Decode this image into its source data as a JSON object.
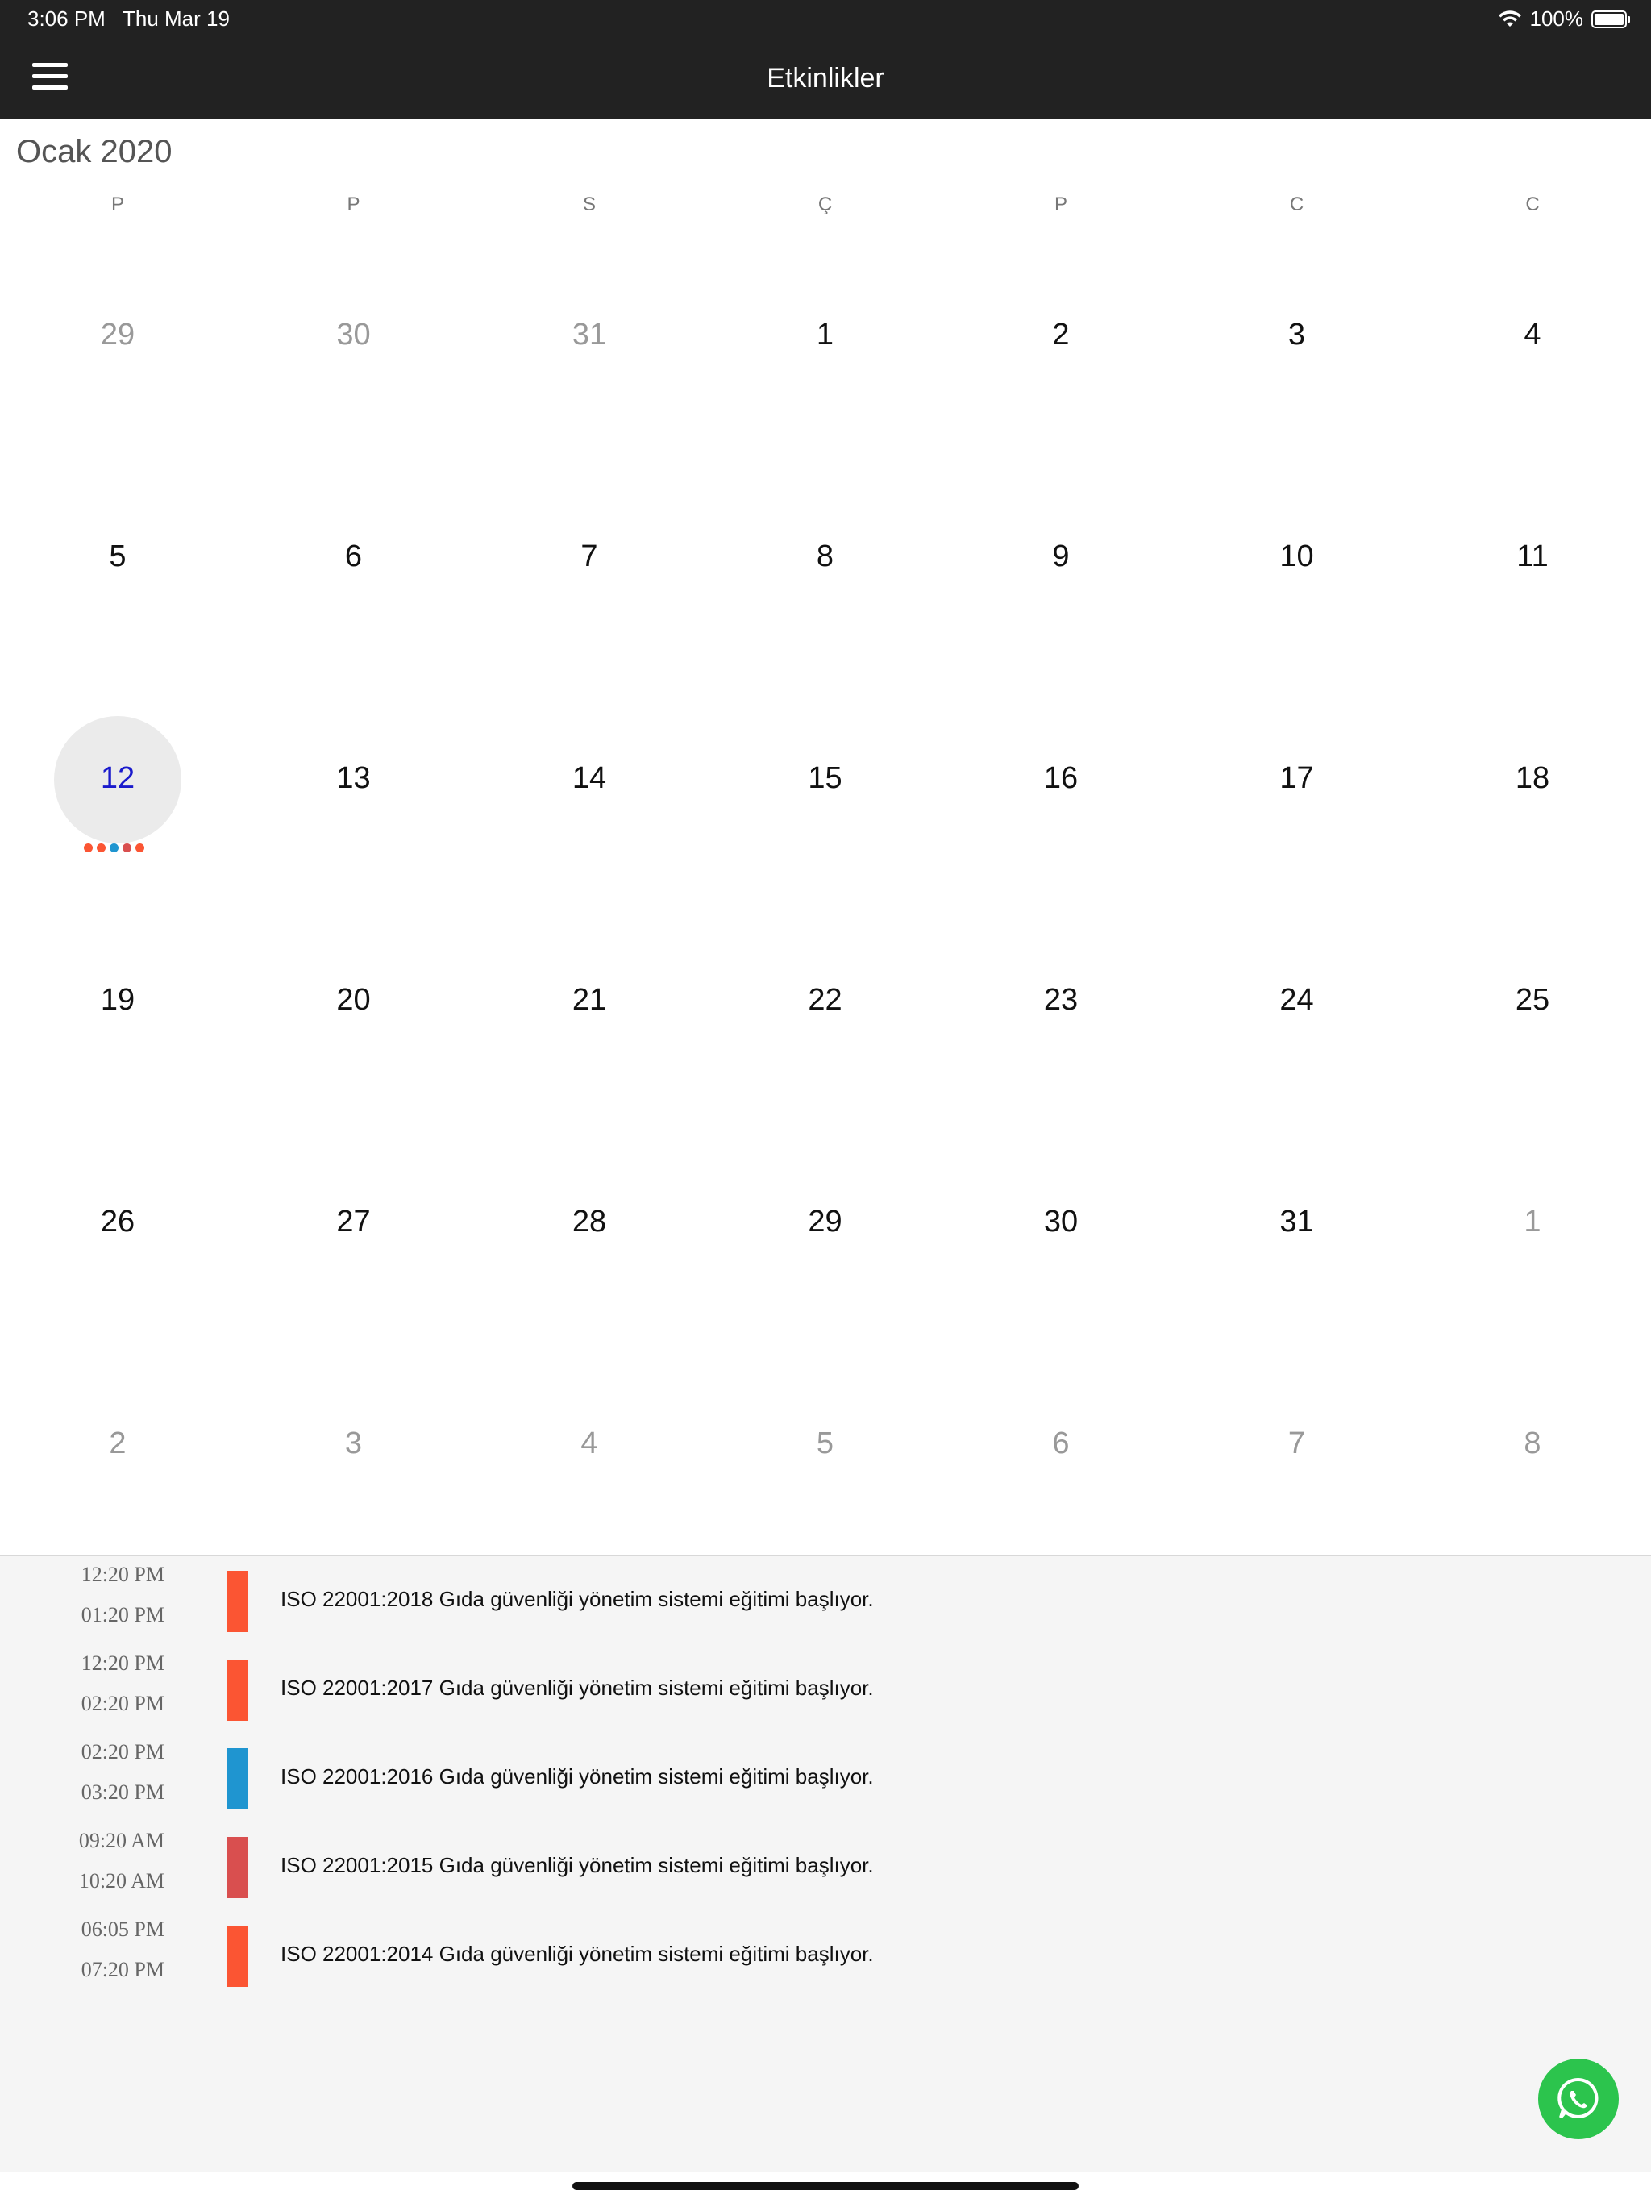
{
  "status_bar": {
    "time": "3:06 PM",
    "date": "Thu Mar 19",
    "battery": "100%"
  },
  "nav": {
    "title": "Etkinlikler",
    "menu_icon": "hamburger-menu-icon"
  },
  "calendar": {
    "month_title": "Ocak 2020",
    "weekdays": [
      "P",
      "P",
      "S",
      "Ç",
      "P",
      "C",
      "C"
    ],
    "weeks": [
      [
        {
          "d": "29",
          "o": true
        },
        {
          "d": "30",
          "o": true
        },
        {
          "d": "31",
          "o": true
        },
        {
          "d": "1"
        },
        {
          "d": "2"
        },
        {
          "d": "3"
        },
        {
          "d": "4"
        }
      ],
      [
        {
          "d": "5"
        },
        {
          "d": "6"
        },
        {
          "d": "7"
        },
        {
          "d": "8"
        },
        {
          "d": "9"
        },
        {
          "d": "10"
        },
        {
          "d": "11"
        }
      ],
      [
        {
          "d": "12",
          "sel": true
        },
        {
          "d": "13"
        },
        {
          "d": "14"
        },
        {
          "d": "15"
        },
        {
          "d": "16"
        },
        {
          "d": "17"
        },
        {
          "d": "18"
        }
      ],
      [
        {
          "d": "19"
        },
        {
          "d": "20"
        },
        {
          "d": "21"
        },
        {
          "d": "22"
        },
        {
          "d": "23"
        },
        {
          "d": "24"
        },
        {
          "d": "25"
        }
      ],
      [
        {
          "d": "26"
        },
        {
          "d": "27"
        },
        {
          "d": "28"
        },
        {
          "d": "29"
        },
        {
          "d": "30"
        },
        {
          "d": "31"
        },
        {
          "d": "1",
          "o": true
        }
      ],
      [
        {
          "d": "2",
          "o": true
        },
        {
          "d": "3",
          "o": true
        },
        {
          "d": "4",
          "o": true
        },
        {
          "d": "5",
          "o": true
        },
        {
          "d": "6",
          "o": true
        },
        {
          "d": "7",
          "o": true
        },
        {
          "d": "8",
          "o": true
        }
      ]
    ],
    "selected_day_dots": [
      "#fb5533",
      "#fb5533",
      "#1f95d0",
      "#d94f4f",
      "#fb5533"
    ]
  },
  "events": [
    {
      "start": "12:20 PM",
      "end": "01:20 PM",
      "color": "#fb5533",
      "title": "ISO 22001:2018 Gıda güvenliği yönetim sistemi eğitimi başlıyor."
    },
    {
      "start": "12:20 PM",
      "end": "02:20 PM",
      "color": "#fb5533",
      "title": "ISO 22001:2017 Gıda güvenliği yönetim sistemi eğitimi başlıyor."
    },
    {
      "start": "02:20 PM",
      "end": "03:20 PM",
      "color": "#1f95d0",
      "title": "ISO 22001:2016 Gıda güvenliği yönetim sistemi eğitimi başlıyor."
    },
    {
      "start": "09:20 AM",
      "end": "10:20 AM",
      "color": "#d94f4f",
      "title": "ISO 22001:2015 Gıda güvenliği yönetim sistemi eğitimi başlıyor."
    },
    {
      "start": "06:05 PM",
      "end": "07:20 PM",
      "color": "#fb5533",
      "title": "ISO 22001:2014 Gıda güvenliği yönetim sistemi eğitimi başlıyor."
    }
  ],
  "fab": {
    "icon": "whatsapp-icon",
    "color": "#2cc44d"
  }
}
